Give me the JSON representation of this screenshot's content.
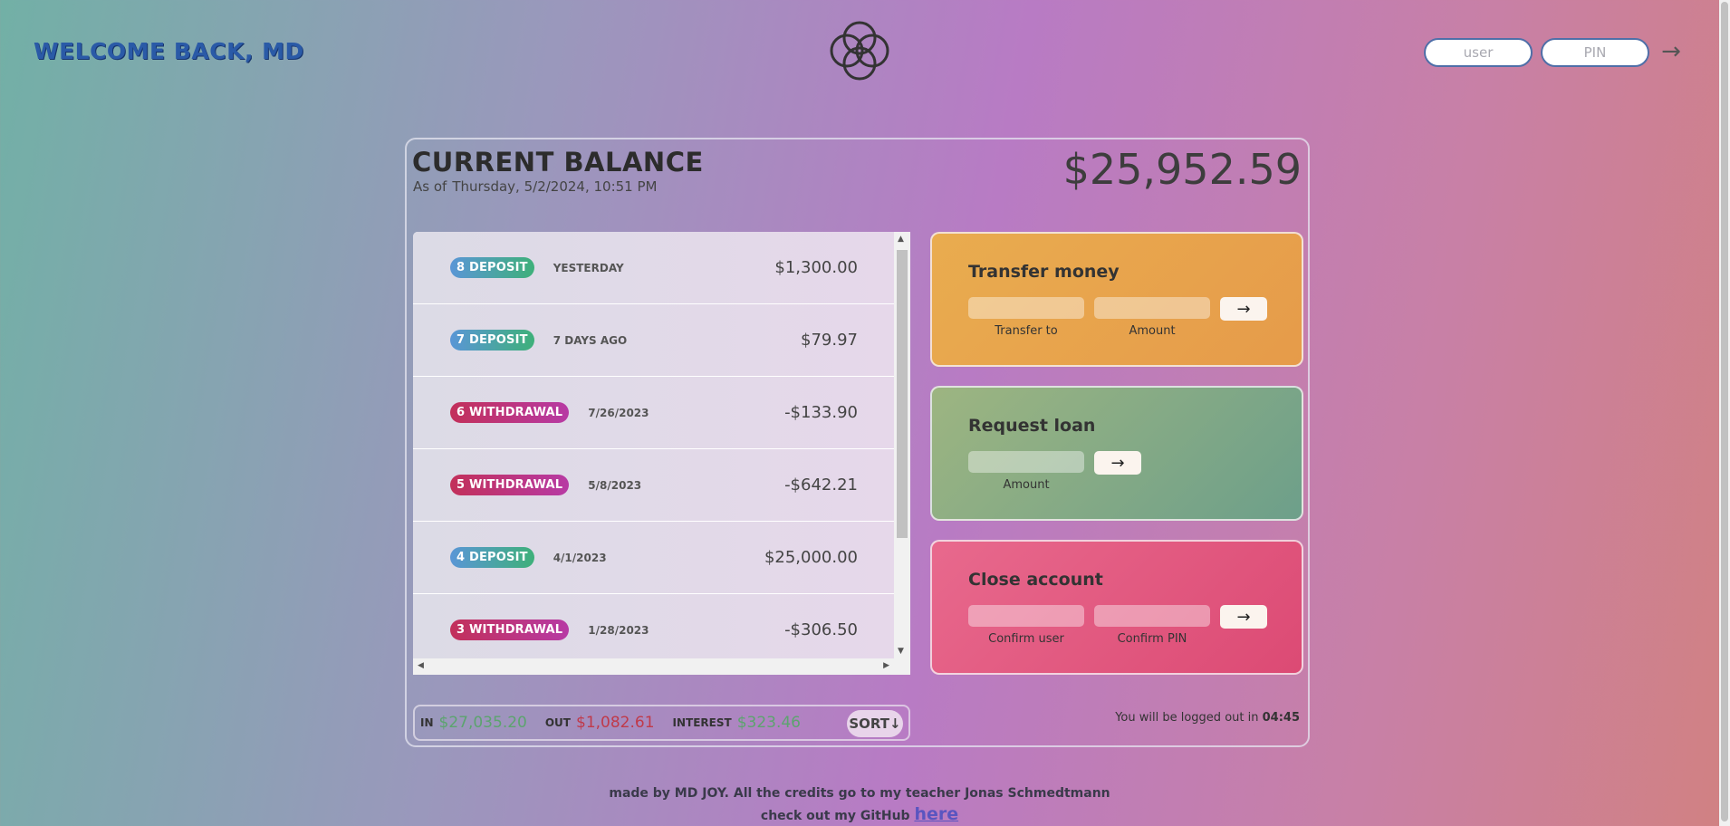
{
  "header": {
    "welcome": "WELCOME BACK, MD",
    "login": {
      "user_placeholder": "user",
      "pin_placeholder": "PIN",
      "button_label": "→"
    }
  },
  "balance": {
    "title": "CURRENT BALANCE",
    "date_prefix": "As of",
    "date": "Thursday, 5/2/2024, 10:51 PM",
    "value": "$25,952.59"
  },
  "movements": [
    {
      "type_label": "8 DEPOSIT",
      "kind": "deposit",
      "date": "YESTERDAY",
      "value": "$1,300.00"
    },
    {
      "type_label": "7 DEPOSIT",
      "kind": "deposit",
      "date": "7 DAYS AGO",
      "value": "$79.97"
    },
    {
      "type_label": "6 WITHDRAWAL",
      "kind": "withdrawal",
      "date": "7/26/2023",
      "value": "-$133.90"
    },
    {
      "type_label": "5 WITHDRAWAL",
      "kind": "withdrawal",
      "date": "5/8/2023",
      "value": "-$642.21"
    },
    {
      "type_label": "4 DEPOSIT",
      "kind": "deposit",
      "date": "4/1/2023",
      "value": "$25,000.00"
    },
    {
      "type_label": "3 WITHDRAWAL",
      "kind": "withdrawal",
      "date": "1/28/2023",
      "value": "-$306.50"
    },
    {
      "type_label": "",
      "kind": "deposit",
      "date": "",
      "value": ""
    }
  ],
  "summary": {
    "in_label": "IN",
    "in_value": "$27,035.20",
    "out_label": "OUT",
    "out_value": "$1,082.61",
    "interest_label": "INTEREST",
    "interest_value": "$323.46",
    "sort_label": "SORT↓"
  },
  "operations": {
    "transfer": {
      "title": "Transfer money",
      "to_label": "Transfer to",
      "amount_label": "Amount",
      "button": "→"
    },
    "loan": {
      "title": "Request loan",
      "amount_label": "Amount",
      "button": "→"
    },
    "close": {
      "title": "Close account",
      "user_label": "Confirm user",
      "pin_label": "Confirm PIN",
      "button": "→"
    }
  },
  "logout": {
    "text": "You will be logged out in",
    "time": "04:45"
  },
  "footer": {
    "line1": "made by MD JOY. All the credits go to my teacher Jonas Schmedtmann",
    "line2": "check out my GitHub",
    "link": "here"
  },
  "colors": {
    "deposit": "#3eb07a",
    "withdrawal": "#c2305a",
    "transfer": "#e9ac4f",
    "loan": "#9db581",
    "close": "#e8698d"
  },
  "icons": {
    "logo": "interlocking-circles-logo",
    "login_arrow": "arrow-right-icon"
  }
}
